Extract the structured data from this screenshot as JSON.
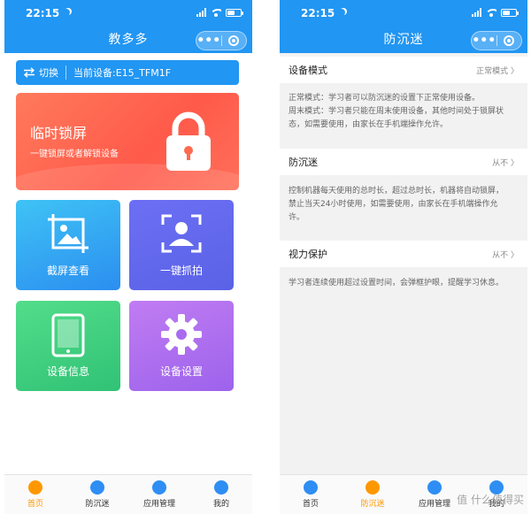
{
  "left": {
    "status": {
      "time": "22:15"
    },
    "nav": {
      "title": "教多多",
      "dots": "•••"
    },
    "switch": {
      "label": "切换",
      "device": "当前设备:E15_TFM1F"
    },
    "lock": {
      "title": "临时锁屏",
      "subtitle": "一键锁屏或者解锁设备"
    },
    "tiles": [
      {
        "label": "截屏查看",
        "icon": "image-icon"
      },
      {
        "label": "一键抓拍",
        "icon": "portrait-capture-icon"
      },
      {
        "label": "设备信息",
        "icon": "tablet-icon"
      },
      {
        "label": "设备设置",
        "icon": "gear-icon"
      }
    ],
    "tabs": [
      {
        "label": "首页",
        "active": true
      },
      {
        "label": "防沉迷",
        "active": false
      },
      {
        "label": "应用管理",
        "active": false
      },
      {
        "label": "我的",
        "active": false
      }
    ]
  },
  "right": {
    "status": {
      "time": "22:15"
    },
    "nav": {
      "title": "防沉迷",
      "dots": "•••"
    },
    "settings": [
      {
        "name": "设备模式",
        "value": "正常模式",
        "desc": [
          "正常模式：学习者可以防沉迷的设置下正常使用设备。",
          "周末模式：学习者只能在周末使用设备，其他时间处于锁屏状",
          "态，如需要使用，由家长在手机端操作允许。"
        ]
      },
      {
        "name": "防沉迷",
        "value": "从不",
        "desc": [
          "控制机器每天使用的总时长，超过总时长，机器将自动锁屏，",
          "禁止当天24小时使用，如需要使用，由家长在手机端操作允",
          "许。"
        ]
      },
      {
        "name": "视力保护",
        "value": "从不",
        "desc": [
          "学习者连续使用超过设置时间，会弹框护眼，提醒学习休息。"
        ]
      }
    ],
    "tabs": [
      {
        "label": "首页",
        "active": false
      },
      {
        "label": "防沉迷",
        "active": true
      },
      {
        "label": "应用管理",
        "active": false
      },
      {
        "label": "我的",
        "active": false
      }
    ]
  },
  "colors": {
    "primary": "#2196f3",
    "active_tab": "#ff9800"
  },
  "watermark": {
    "text": "值 什么值得买",
    "logo_char": "值"
  }
}
